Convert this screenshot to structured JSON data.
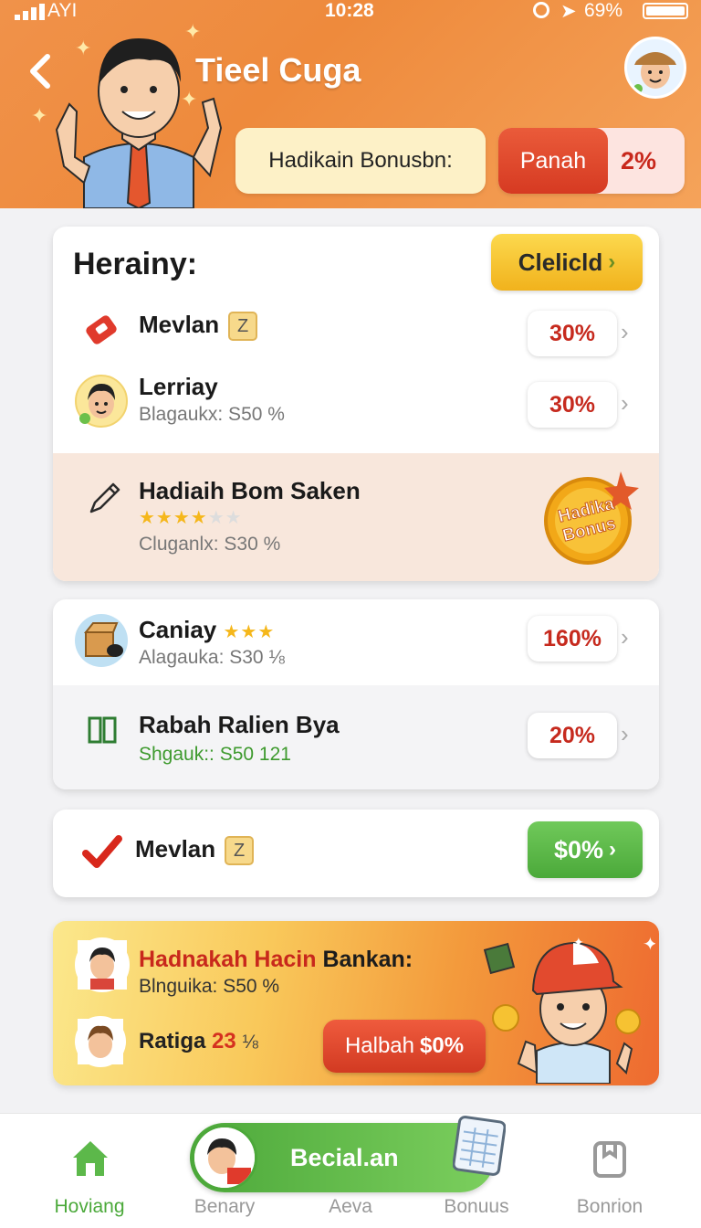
{
  "status": {
    "carrier": "AYI",
    "time": "10:28",
    "battery": "69%"
  },
  "header": {
    "title": "Tieel Cuga",
    "bonus_label": "Hadikain Bonusbn:",
    "panah_label": "Panah",
    "panah_value": "2%"
  },
  "section1": {
    "title": "Herainy:",
    "action_label": "Clelicld",
    "rows": [
      {
        "name": "Mevlan",
        "tag": "Z",
        "value": "30%"
      },
      {
        "name": "Lerriay",
        "sub": "Blagaukx: S50 %",
        "value": "30%"
      },
      {
        "name": "Hadiaih Bom Saken",
        "stars": "★★★★",
        "stars_off": "★★",
        "sub": "Cluganlx: S30 %",
        "badge_line1": "Hadika",
        "badge_line2": "Bonus"
      }
    ]
  },
  "section2": {
    "rows": [
      {
        "name": "Caniay",
        "stars": "★★★",
        "sub": "Alagauka: S30 ⅛",
        "value": "160%"
      },
      {
        "name": "Rabah Ralien Bya",
        "sub": "Shgauk:: S50 121",
        "value": "20%"
      }
    ]
  },
  "section3": {
    "name": "Mevlan",
    "tag": "Z",
    "button": "$0%"
  },
  "promo": {
    "title_red": "Hadnakah Hacin",
    "title_dark": "Bankan:",
    "sub": "Blnguika: S50 %",
    "ratiga_label": "Ratiga",
    "ratiga_value": "23",
    "ratiga_unit": "⅛",
    "button_text": "Halbah",
    "button_value": "$0%"
  },
  "bottom_nav": {
    "items": [
      {
        "label": "Hoviang",
        "icon": "home-icon"
      },
      {
        "label": "Benary",
        "icon": "avatar-icon"
      },
      {
        "label": "Aeva",
        "icon": "none"
      },
      {
        "label": "Bonuus",
        "icon": "calendar-icon"
      },
      {
        "label": "Bonrion",
        "icon": "bookmark-icon"
      }
    ],
    "center_label": "Becial.an"
  },
  "colors": {
    "header_orange": "#ee8a3c",
    "accent_red": "#c8281c",
    "accent_green": "#4ba93a",
    "accent_yellow": "#f1b21c"
  }
}
